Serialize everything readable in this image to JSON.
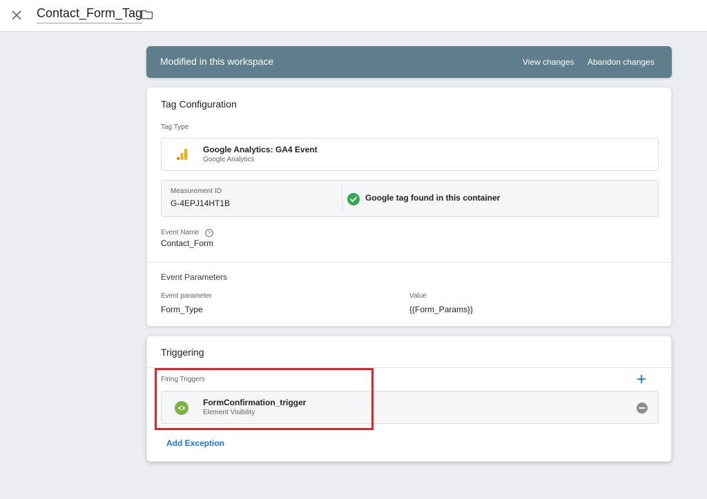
{
  "header": {
    "close_icon": "close-icon",
    "title": "Contact_Form_Tag",
    "folder_icon": "folder-icon"
  },
  "banner": {
    "text": "Modified in this workspace",
    "view_changes": "View changes",
    "abandon_changes": "Abandon changes"
  },
  "tag_config": {
    "title": "Tag Configuration",
    "tag_type_label": "Tag Type",
    "tag_type_name": "Google Analytics: GA4 Event",
    "tag_type_sub": "Google Analytics",
    "measurement_label": "Measurement ID",
    "measurement_value": "G-4EPJ14HT1B",
    "google_tag_status": "Google tag found in this container",
    "event_name_label": "Event Name",
    "event_name_value": "Contact_Form",
    "event_params_title": "Event Parameters",
    "param_col_header": "Event parameter",
    "value_col_header": "Value",
    "params": [
      {
        "parameter": "Form_Type",
        "value": "{{Form_Params}}"
      }
    ]
  },
  "triggering": {
    "title": "Triggering",
    "firing_label": "Firing Triggers",
    "trigger_name": "FormConfirmation_trigger",
    "trigger_type": "Element Visibility",
    "add_exception": "Add Exception"
  },
  "colors": {
    "banner_bg": "#5f7d8a",
    "link_blue": "#1a73e8",
    "check_green": "#34a853",
    "trigger_green": "#7cb342",
    "highlight_red": "#e0222a",
    "ga_orange": "#f9ab00"
  }
}
